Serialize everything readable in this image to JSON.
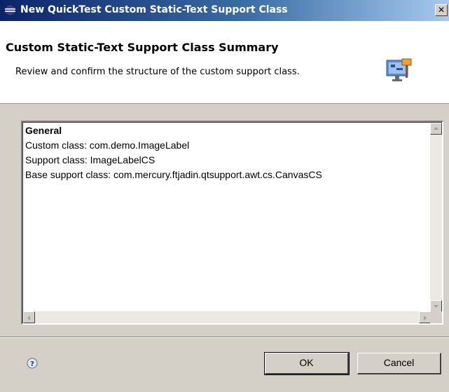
{
  "window": {
    "title": "New QuickTest Custom Static-Text Support Class",
    "close_glyph": "✕"
  },
  "header": {
    "title": "Custom Static-Text Support Class Summary",
    "description": "Review and confirm the structure of the custom support class."
  },
  "summary": {
    "heading": "General",
    "lines": [
      "Custom class: com.demo.ImageLabel",
      "Support class: ImageLabelCS",
      "Base support class: com.mercury.ftjadin.qtsupport.awt.cs.CanvasCS"
    ]
  },
  "footer": {
    "ok_label": "OK",
    "cancel_label": "Cancel"
  },
  "icons": {
    "title": "eclipse-icon",
    "wizard": "wizard-banner-icon",
    "help": "help-icon"
  },
  "colors": {
    "titlebar_start": "#0a246a",
    "titlebar_end": "#a6caf0",
    "dialog_bg": "#d4d0c8",
    "header_bg": "#ffffff"
  }
}
